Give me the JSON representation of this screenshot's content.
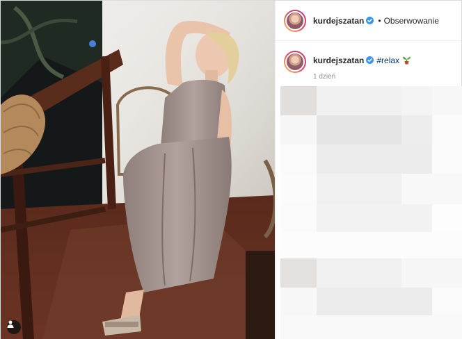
{
  "post": {
    "username": "kurdejszatan",
    "follow_label": "Obserwowanie",
    "caption_hashtag": "#relax",
    "time_ago": "1 dzień"
  },
  "icons": {
    "verified": "verified-badge-icon",
    "tag": "person-tag-icon",
    "emoji": "potted-plant-icon"
  },
  "colors": {
    "accent": "#0095f6",
    "hashtag": "#00376b"
  }
}
